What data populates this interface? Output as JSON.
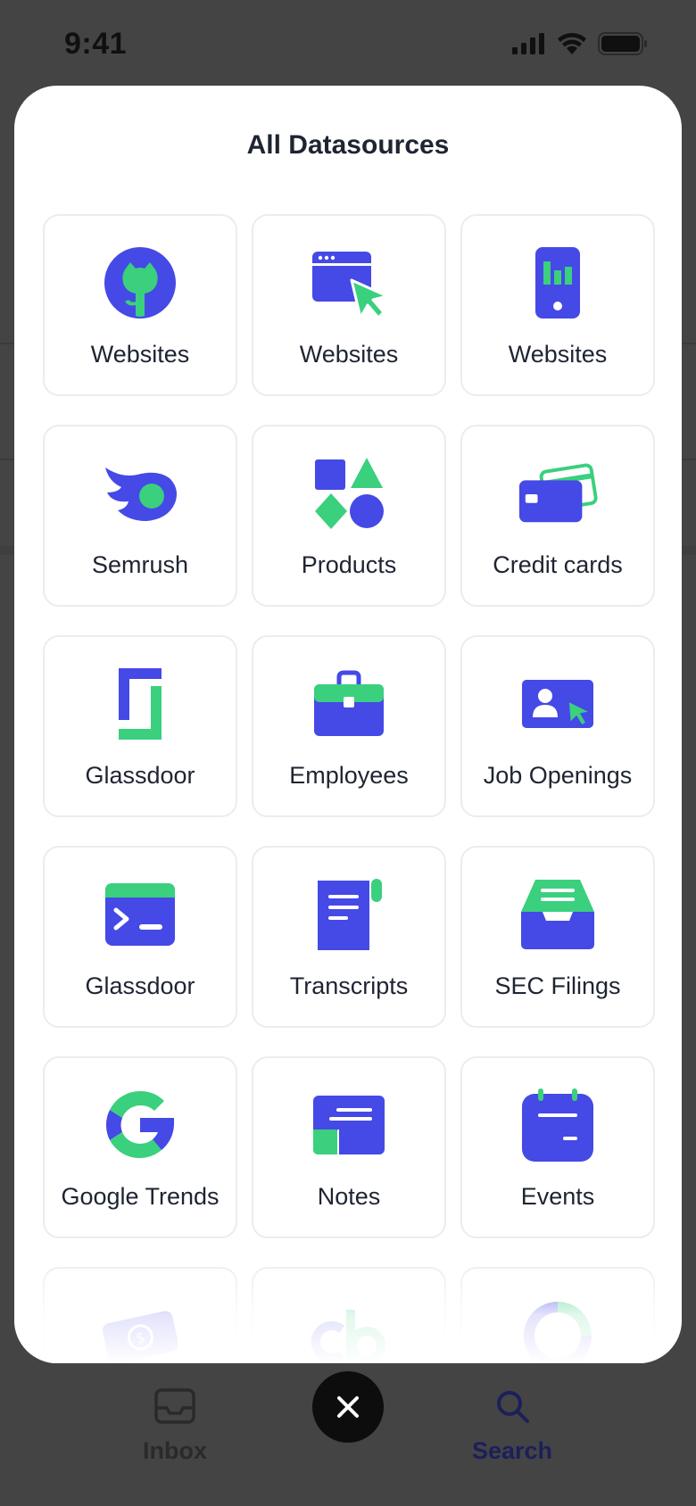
{
  "status_bar": {
    "time": "9:41"
  },
  "modal": {
    "title": "All Datasources",
    "tiles": [
      {
        "label": "Websites",
        "icon": "github-icon"
      },
      {
        "label": "Websites",
        "icon": "browser-cursor-icon"
      },
      {
        "label": "Websites",
        "icon": "mobile-chart-icon"
      },
      {
        "label": "Semrush",
        "icon": "semrush-icon"
      },
      {
        "label": "Products",
        "icon": "shapes-icon"
      },
      {
        "label": "Credit cards",
        "icon": "credit-cards-icon"
      },
      {
        "label": "Glassdoor",
        "icon": "glassdoor-icon"
      },
      {
        "label": "Employees",
        "icon": "briefcase-icon"
      },
      {
        "label": "Job Openings",
        "icon": "job-profile-icon"
      },
      {
        "label": "Glassdoor",
        "icon": "terminal-icon"
      },
      {
        "label": "Transcripts",
        "icon": "document-icon"
      },
      {
        "label": "SEC Filings",
        "icon": "inbox-tray-icon"
      },
      {
        "label": "Google Trends",
        "icon": "google-icon"
      },
      {
        "label": "Notes",
        "icon": "notes-icon"
      },
      {
        "label": "Events",
        "icon": "calendar-icon"
      },
      {
        "label": "",
        "icon": "money-icon"
      },
      {
        "label": "",
        "icon": "crunchbase-icon"
      },
      {
        "label": "",
        "icon": "donut-icon"
      }
    ]
  },
  "tabbar": {
    "inbox_label": "Inbox",
    "search_label": "Search",
    "close_icon": "close-icon"
  },
  "colors": {
    "primary": "#4549e6",
    "accent": "#3ad07d",
    "text": "#1e2432",
    "tab_inactive": "#2a2a2a",
    "tab_active": "#1c1f5a"
  }
}
